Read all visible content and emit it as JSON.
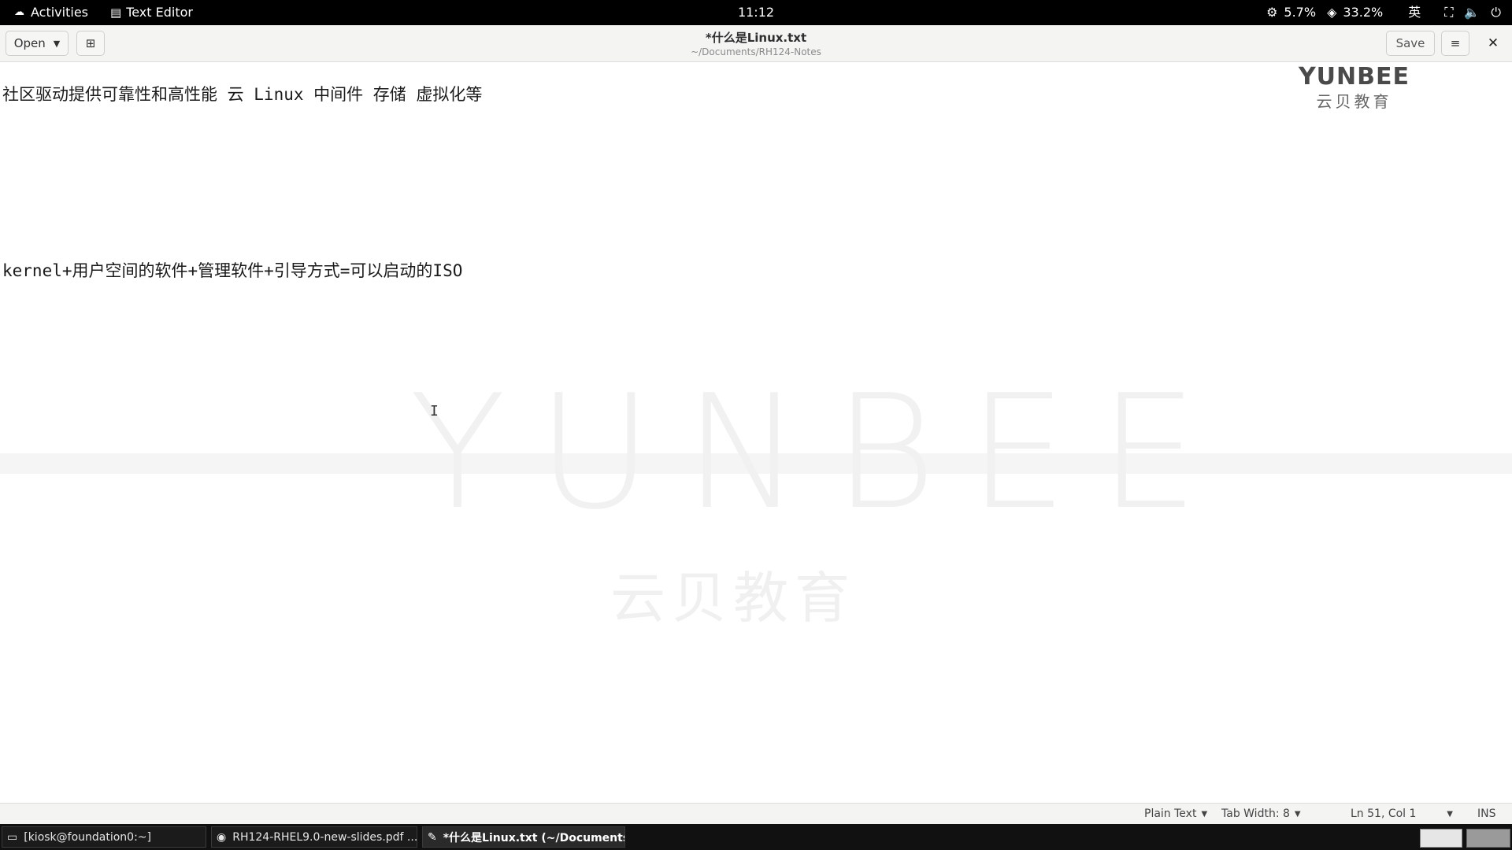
{
  "topbar": {
    "activities": "Activities",
    "app_name": "Text Editor",
    "clock": "11:12",
    "cpu": "5.7%",
    "mem": "33.2%",
    "input_method": "英"
  },
  "header": {
    "open_label": "Open",
    "title": "*什么是Linux.txt",
    "path": "~/Documents/RH124-Notes",
    "save_label": "Save"
  },
  "editor": {
    "lines": [
      "社区驱动提供可靠性和高性能 云 Linux 中间件 存储 虚拟化等",
      "kernel+用户空间的软件+管理软件+引导方式=可以启动的ISO"
    ]
  },
  "watermark": {
    "corner_en": "YUNBEE",
    "corner_cn": "云贝教育",
    "center_en": "YUNBEE",
    "center_cn": "云贝教育"
  },
  "statusbar": {
    "language": "Plain Text",
    "tab_width": "Tab Width: 8",
    "position": "Ln 51, Col 1",
    "mode": "INS"
  },
  "taskbar": {
    "tasks": [
      {
        "label": "[kiosk@foundation0:~]",
        "icon": "terminal-icon"
      },
      {
        "label": "RH124-RHEL9.0-new-slides.pdf ...",
        "icon": "document-viewer-icon"
      },
      {
        "label": "*什么是Linux.txt (~/Documents/R...",
        "icon": "text-editor-icon"
      }
    ]
  }
}
